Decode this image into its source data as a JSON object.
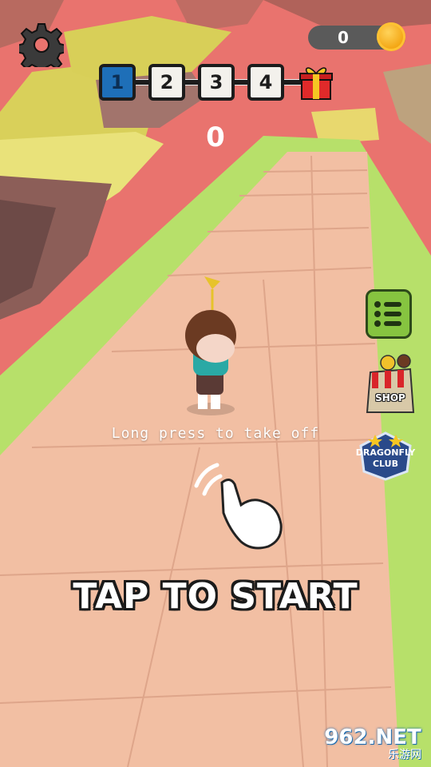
{
  "hud": {
    "coin_count": "0",
    "score": "0",
    "levels": [
      {
        "label": "1",
        "state": "current"
      },
      {
        "label": "2",
        "state": "locked"
      },
      {
        "label": "3",
        "state": "locked"
      },
      {
        "label": "4",
        "state": "locked"
      }
    ]
  },
  "side_buttons": {
    "shop_label": "SHOP",
    "club_label_line1": "DRAGONFLY",
    "club_label_line2": "CLUB"
  },
  "hint_text": "Long press to take off",
  "cta_text": "TAP TO START",
  "watermark": {
    "main": "962.NET",
    "sub": "乐游网"
  },
  "colors": {
    "sky": "#e9736e",
    "grass": "#b7e06a",
    "path": "#f2bfa3",
    "coin": "#f2a20e",
    "active_level": "#1e6fb8",
    "menu_button": "#86c440"
  }
}
